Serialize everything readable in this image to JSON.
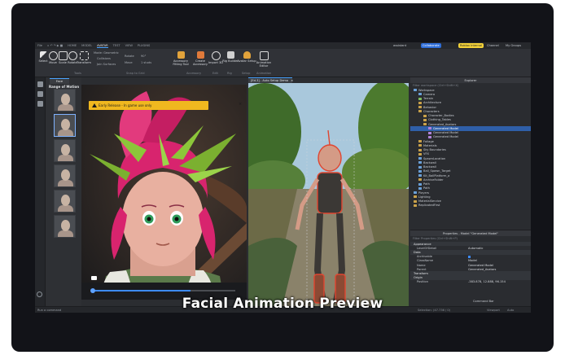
{
  "menubar": {
    "app_label": "File",
    "tabs": [
      {
        "label": "HOME",
        "active": false
      },
      {
        "label": "MODEL",
        "active": false
      },
      {
        "label": "AVATAR",
        "active": true
      },
      {
        "label": "TEST",
        "active": false
      },
      {
        "label": "VIEW",
        "active": false
      },
      {
        "label": "PLUGINS",
        "active": false
      }
    ],
    "right": {
      "user": "assistant",
      "collab": "Collaborate",
      "badge": "Roblox Internal",
      "channel": "Channel",
      "extra": "My Groups"
    }
  },
  "ribbon": {
    "tools": [
      "Select",
      "Move",
      "Scale",
      "Rotate",
      "Transform"
    ],
    "tools_group": "Tools",
    "mode_options": [
      "Mode: Geometric",
      "Collisions",
      "Join Surfaces"
    ],
    "snap_options": [
      "Rotate",
      "Move"
    ],
    "snap_values": [
      "90°",
      "1 studs"
    ],
    "snap_group": "Snap to Grid",
    "avatar_buttons": [
      "Accessory Fitting Tool",
      "Create Accessory"
    ],
    "avatar_group": "Accessory",
    "fit_button": "Import 3D",
    "rig_button": "Rig Builder",
    "avatar_setup": "Avatar Setup",
    "anim_button": "Animation Editor",
    "group_labels": [
      "Edit",
      "Rig",
      "Setup",
      "Animation"
    ],
    "avatar_setup_group": "Avatar Setup"
  },
  "face_panel": {
    "tab_label": "Face",
    "heading": "Range of Motion",
    "thumb_count": 6
  },
  "face_view": {
    "banner": "Early Release - In game use only",
    "banner_close": "×"
  },
  "viewport": {
    "tab_label": "[Ed.3] - Auto Setup Demo"
  },
  "explorer": {
    "title": "Explorer",
    "filter": "Filter workspace (Ctrl+Shift+X)",
    "items": [
      {
        "label": "Workspace",
        "indent": 0,
        "icon": "o"
      },
      {
        "label": "Camera",
        "indent": 1,
        "icon": "o"
      },
      {
        "label": "Terrain",
        "indent": 1,
        "icon": "g"
      },
      {
        "label": "Architecture",
        "indent": 1,
        "icon": ""
      },
      {
        "label": "Behavior",
        "indent": 1,
        "icon": ""
      },
      {
        "label": "Characters",
        "indent": 1,
        "icon": ""
      },
      {
        "label": "Character_Bodies",
        "indent": 2,
        "icon": ""
      },
      {
        "label": "Clothing_Tables",
        "indent": 2,
        "icon": ""
      },
      {
        "label": "Generated_Avatars",
        "indent": 2,
        "icon": ""
      },
      {
        "label": "Generated Model",
        "indent": 3,
        "icon": "p",
        "selected": true
      },
      {
        "label": "Generated Model",
        "indent": 3,
        "icon": "p"
      },
      {
        "label": "Generated Model",
        "indent": 3,
        "icon": "p"
      },
      {
        "label": "Foliage",
        "indent": 1,
        "icon": ""
      },
      {
        "label": "Materials",
        "indent": 1,
        "icon": ""
      },
      {
        "label": "Sky Boundaries",
        "indent": 1,
        "icon": ""
      },
      {
        "label": "VFX",
        "indent": 1,
        "icon": ""
      },
      {
        "label": "SpawnLocation",
        "indent": 1,
        "icon": "o"
      },
      {
        "label": "Backwall",
        "indent": 1,
        "icon": "o"
      },
      {
        "label": "Backwall",
        "indent": 1,
        "icon": "o"
      },
      {
        "label": "Ball_Spawn_Target",
        "indent": 1,
        "icon": "o"
      },
      {
        "label": "Kit_BallPlatform_a",
        "indent": 1,
        "icon": "o"
      },
      {
        "label": "ArchiveFolder",
        "indent": 1,
        "icon": ""
      },
      {
        "label": "Path",
        "indent": 1,
        "icon": "o"
      },
      {
        "label": "Path",
        "indent": 1,
        "icon": "o"
      },
      {
        "label": "Players",
        "indent": 0,
        "icon": "o"
      },
      {
        "label": "Lighting",
        "indent": 0,
        "icon": ""
      },
      {
        "label": "MaterialService",
        "indent": 0,
        "icon": ""
      },
      {
        "label": "ReplicatedFirst",
        "indent": 0,
        "icon": ""
      }
    ]
  },
  "properties": {
    "title": "Properties - Model \"Generated Model\"",
    "filter": "Filter Properties (Ctrl+Shift+P)",
    "rows": [
      {
        "section": "Appearance"
      },
      {
        "k": "LevelOfDetail",
        "v": "Automatic"
      },
      {
        "section": "Data"
      },
      {
        "k": "Archivable",
        "v": "",
        "check": true
      },
      {
        "k": "ClassName",
        "v": "Model"
      },
      {
        "k": "Name",
        "v": "Generated Model"
      },
      {
        "k": "Parent",
        "v": "Generated_Avatars"
      },
      {
        "section": "Transform"
      },
      {
        "section": "Origin"
      },
      {
        "k": "Position",
        "v": "-383.878, 12.888, 96.154"
      }
    ]
  },
  "status": {
    "left_text": "Run a command",
    "right_items": [
      "Selection: (47.736 / 0)",
      "Viewport",
      "Auto"
    ],
    "command_bar": "Command Bar"
  },
  "caption": "Facial Animation Preview",
  "colors": {
    "accent": "#4aa3ff",
    "banner": "#f0b81f",
    "hair": "#d8246e",
    "leaves": "#8cc63a",
    "skin": "#e8b0a0"
  }
}
